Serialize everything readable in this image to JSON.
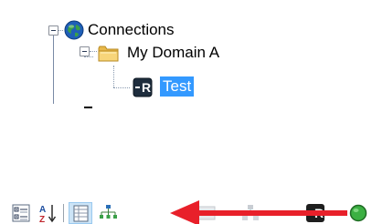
{
  "tree": {
    "root": {
      "label": "Connections",
      "icon": "globe-icon",
      "expanded": true
    },
    "group": {
      "label": "My Domain A",
      "icon": "folder-icon",
      "expanded": true
    },
    "leaf": {
      "label": "Test",
      "icon": "rdp-connection-icon",
      "badge": "R",
      "selected": true
    }
  },
  "toolbar": {
    "buttons": [
      {
        "name": "categorized-view-button",
        "icon": "categorized-icon",
        "active": false
      },
      {
        "name": "alphabetical-sort-button",
        "icon": "sort-az-icon",
        "glyph_top": "A",
        "glyph_bottom": "Z",
        "active": false
      },
      {
        "name": "properties-button",
        "icon": "property-grid-icon",
        "active": true
      },
      {
        "name": "inheritance-button",
        "icon": "hierarchy-icon",
        "active": false
      },
      {
        "name": "disabled-button-1",
        "icon": "grey-rect-icon",
        "active": false
      },
      {
        "name": "disabled-button-2",
        "icon": "grey-hierarchy-icon",
        "active": false
      },
      {
        "name": "rdp-button",
        "icon": "rdp-icon",
        "badge": "R",
        "active": false
      },
      {
        "name": "status-button",
        "icon": "green-dot-icon",
        "active": false
      }
    ]
  },
  "colors": {
    "selection": "#3399ff",
    "tree_line": "#8a9bb0",
    "arrow": "#e8202a",
    "status_green": "#3cb043"
  }
}
